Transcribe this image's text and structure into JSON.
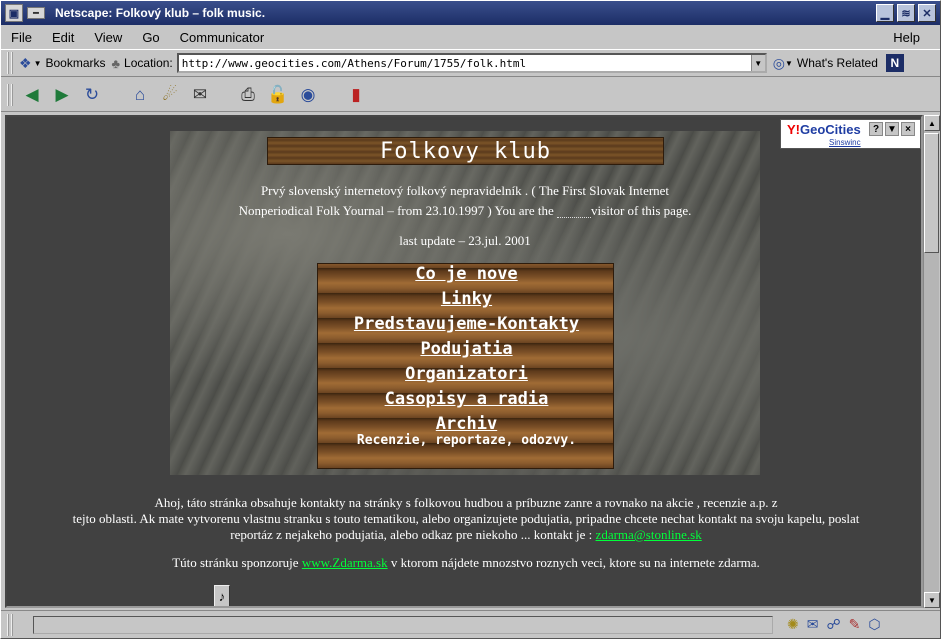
{
  "window": {
    "title": "Netscape: Folkový klub – folk music."
  },
  "menu": [
    "File",
    "Edit",
    "View",
    "Go",
    "Communicator"
  ],
  "menu_help": "Help",
  "location": {
    "bookmarks_label": "Bookmarks",
    "location_label": "Location:",
    "url": "http://www.geocities.com/Athens/Forum/1755/folk.html",
    "related_label": "What's Related"
  },
  "geocities": {
    "brand_y": "Y!",
    "brand": "GeoCities",
    "help": "?",
    "close": "×",
    "sub": "Sinswinc"
  },
  "page": {
    "title": "Folkovy klub",
    "intro_1": "Prvý slovenský internetový folkový nepravidelník . ( The First Slovak Internet",
    "intro_2": "Nonperiodical Folk Yournal – from 23.10.1997 ) You are the",
    "intro_3": "visitor of this page.",
    "update": "last update – 23.jul. 2001",
    "nav": [
      "Co je nove",
      "Linky",
      "Predstavujeme-Kontakty",
      "Podujatia",
      "Organizatori",
      "Casopisy a radia",
      "Archiv"
    ],
    "nav_sub": "Recenzie, reportaze, odozvy.",
    "main_1": "Ahoj, táto stránka obsahuje kontakty na stránky s folkovou hudbou a príbuzne zanre a rovnako na akcie , recenzie a.p. z",
    "main_2": "tejto oblasti. Ak mate vytvorenu vlastnu stranku s touto tematikou, alebo organizujete podujatia, pripadne chcete nechat kontakt na svoju kapelu, poslat",
    "main_3": "reportáz z nejakeho podujatia, alebo odkaz pre niekoho ... kontakt je :",
    "email": "zdarma@stonline.sk",
    "sponsor_1": "Túto stránku sponzoruje",
    "sponsor_link": "www.Zdarma.sk",
    "sponsor_2": "v ktorom nájdete mnozstvo roznych veci, ktore su na internete zdarma."
  }
}
